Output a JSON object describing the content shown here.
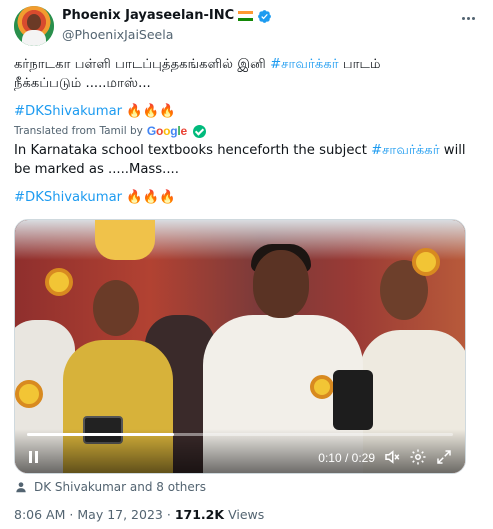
{
  "author": {
    "name": "Phoenix Jayaseelan-INC",
    "handle": "@PhoenixJaiSeela",
    "verified": true
  },
  "tweet": {
    "tamil_line1_a": "கர்நாடகா பள்ளி பாடப்புத்தகங்களில் இனி ",
    "tamil_hashtag": "#சாவர்க்கர்",
    "tamil_line1_b": " பாடம்",
    "tamil_line2": "நீக்கப்படும் .....மாஸ்...",
    "tamil_tag_line": "#DKShivakumar",
    "translated_label": "Translated from Tamil by",
    "translator": "Google",
    "english_a": "In Karnataka school textbooks henceforth the subject ",
    "english_hashtag": "#சாவர்க்கர்",
    "english_b": " will be marked as .....Mass....",
    "english_tag_line": "#DKShivakumar",
    "fire_emojis": "🔥🔥🔥"
  },
  "video": {
    "time_display": "0:10 / 0:29",
    "progress_fraction": 0.345
  },
  "tagged": "DK Shivakumar and 8 others",
  "meta": {
    "time": "8:06 AM",
    "sep": "·",
    "date": "May 17, 2023",
    "views_count": "171.2K",
    "views_label": "Views"
  },
  "colors": {
    "link": "#1d9bf0",
    "secondary_text": "#536471",
    "verified": "#1d9bf0"
  }
}
